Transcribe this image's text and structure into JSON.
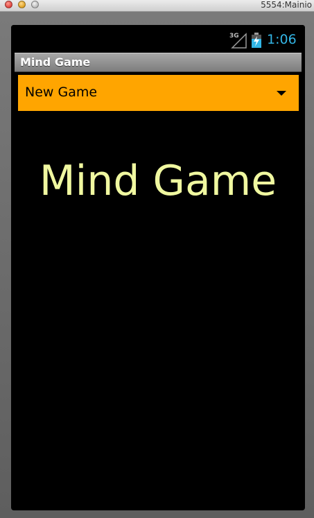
{
  "window": {
    "title": "5554:Mainio"
  },
  "status_bar": {
    "network_label": "3G",
    "time": "1:06",
    "clock_color": "#33b5e5"
  },
  "app_bar": {
    "title": "Mind Game"
  },
  "spinner": {
    "selected": "New Game",
    "background_color": "#ffa500"
  },
  "main": {
    "headline": "Mind Game",
    "headline_color": "#f0f8a0"
  }
}
